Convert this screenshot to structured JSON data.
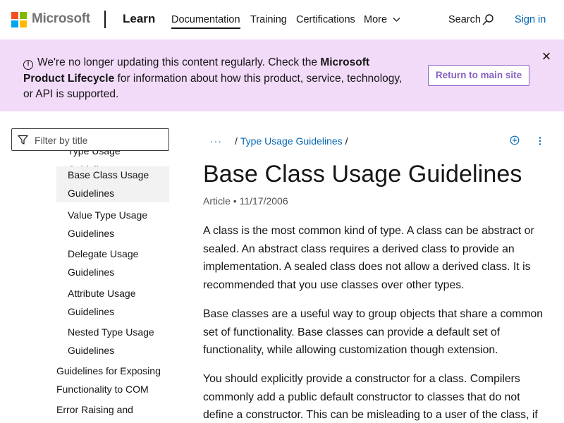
{
  "header": {
    "brand": "Microsoft",
    "product": "Learn",
    "nav": [
      {
        "label": "Documentation",
        "active": true
      },
      {
        "label": "Training"
      },
      {
        "label": "Certifications"
      },
      {
        "label": "More"
      }
    ],
    "search_label": "Search",
    "signin_label": "Sign in",
    "logo_colors": [
      "#f25022",
      "#7fba00",
      "#00a4ef",
      "#ffb900"
    ]
  },
  "banner": {
    "text_pre": "We're no longer updating this content regularly. Check the ",
    "text_link": "Microsoft Product Lifecycle",
    "text_post": " for information about how this product, service, technology, or API is supported.",
    "button_label": "Return to main site",
    "close_symbol": "×",
    "background": "#f2daf9",
    "accent": "#8661c5"
  },
  "sidebar": {
    "filter_placeholder": "Filter by title",
    "items": [
      {
        "label": "Type Usage Guidelines"
      },
      {
        "label": "Base Class Usage Guidelines",
        "selected": true
      },
      {
        "label": "Value Type Usage Guidelines"
      },
      {
        "label": "Delegate Usage Guidelines"
      },
      {
        "label": "Attribute Usage Guidelines"
      },
      {
        "label": "Nested Type Usage Guidelines"
      },
      {
        "label": "Guidelines for Exposing Functionality to COM"
      },
      {
        "label": "Error Raising and"
      }
    ]
  },
  "main": {
    "breadcrumb_dots": "···",
    "breadcrumb": [
      {
        "label": "Type Usage Guidelines"
      }
    ],
    "title": "Base Class Usage Guidelines",
    "meta_type": "Article",
    "meta_sep": "•",
    "meta_date": "11/17/2006",
    "paragraphs": [
      "A class is the most common kind of type. A class can be abstract or sealed. An abstract class requires a derived class to provide an implementation. A sealed class does not allow a derived class. It is recommended that you use classes over other types.",
      "Base classes are a useful way to group objects that share a common set of functionality. Base classes can provide a default set of functionality, while allowing customization though extension.",
      "You should explicitly provide a constructor for a class. Compilers commonly add a public default constructor to classes that do not define a constructor. This can be misleading to a user of the class, if"
    ]
  }
}
